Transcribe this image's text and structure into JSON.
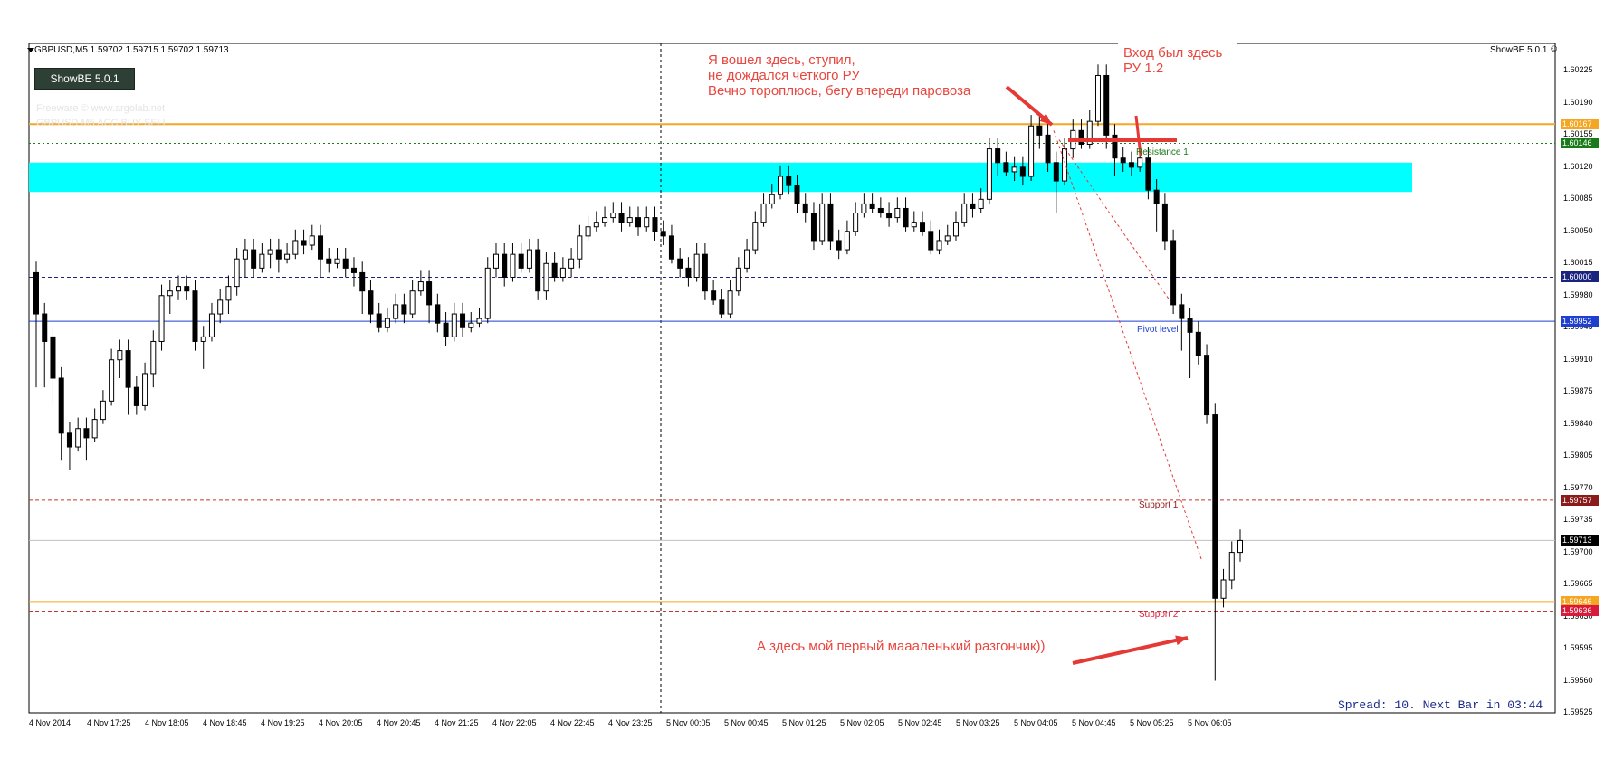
{
  "window": {
    "symbol_header": "GBPUSD,M5  1.59702 1.59715 1.59702 1.59713",
    "indicator_name": "ShowBE 5.0.1",
    "button_label": "ShowBE 5.0.1",
    "faint_text_1": "Freeware © www.argolab.net",
    "faint_text_2": "GBPUSD  M5  ACC  BUY  SELL",
    "spread_text": "Spread: 10. Next Bar in 03:44"
  },
  "annotations": {
    "note_1": [
      "Я вошел здесь, ступил,",
      "не дождался четкого РУ",
      "Вечно тороплюсь, бегу впереди паровоза"
    ],
    "note_2": [
      "Вход был здесь",
      "РУ 1.2"
    ],
    "note_3": "А здесь мой первый маааленький разгончик))"
  },
  "levels": {
    "resistance_1": "Resistance 1",
    "pivot": "Pivot level",
    "support_1": "Support 1",
    "support_2": "Support 2"
  },
  "price_axis": {
    "ticks": [
      "1.60225",
      "1.60190",
      "1.60155",
      "1.60120",
      "1.60085",
      "1.60050",
      "1.60015",
      "1.59980",
      "1.59945",
      "1.59910",
      "1.59875",
      "1.59840",
      "1.59805",
      "1.59770",
      "1.59735",
      "1.59700",
      "1.59665",
      "1.59630",
      "1.59595",
      "1.59560",
      "1.59525"
    ],
    "tags": [
      {
        "text": "1.60167",
        "color": "#f5a623",
        "price": 1.60167
      },
      {
        "text": "1.60146",
        "color": "#1a7a1a",
        "price": 1.60146
      },
      {
        "text": "1.60000",
        "color": "#1a237e",
        "price": 1.6
      },
      {
        "text": "1.59952",
        "color": "#1e3fd0",
        "price": 1.59952
      },
      {
        "text": "1.59757",
        "color": "#8b1a1a",
        "price": 1.59757
      },
      {
        "text": "1.59713",
        "color": "#000000",
        "price": 1.59713
      },
      {
        "text": "1.59646",
        "color": "#f5a623",
        "price": 1.59646
      },
      {
        "text": "1.59636",
        "color": "#d81b3c",
        "price": 1.59636
      }
    ]
  },
  "time_axis": {
    "ticks": [
      "4 Nov 2014",
      "4 Nov 17:25",
      "4 Nov 18:05",
      "4 Nov 18:45",
      "4 Nov 19:25",
      "4 Nov 20:05",
      "4 Nov 20:45",
      "4 Nov 21:25",
      "4 Nov 22:05",
      "4 Nov 22:45",
      "4 Nov 23:25",
      "5 Nov 00:05",
      "5 Nov 00:45",
      "5 Nov 01:25",
      "5 Nov 02:05",
      "5 Nov 02:45",
      "5 Nov 03:25",
      "5 Nov 04:05",
      "5 Nov 04:45",
      "5 Nov 05:25",
      "5 Nov 06:05"
    ]
  },
  "chart_data": {
    "type": "candlestick",
    "symbol": "GBPUSD",
    "timeframe": "M5",
    "ylim": [
      1.59525,
      1.60255
    ],
    "last": {
      "open": 1.59702,
      "high": 1.59715,
      "low": 1.59702,
      "close": 1.59713
    },
    "horizontal_levels": [
      {
        "name": "Resistance 1",
        "price": 1.60146,
        "color": "#1a7a1a",
        "style": "dotted"
      },
      {
        "name": "Pivot level",
        "price": 1.59952,
        "color": "#1e3fd0",
        "style": "solid"
      },
      {
        "name": "Support 1",
        "price": 1.59757,
        "color": "#c0392b",
        "style": "dashed"
      },
      {
        "name": "Support 2",
        "price": 1.59636,
        "color": "#c0392b",
        "style": "dashed"
      },
      {
        "price": 1.60167,
        "color": "#f5a623",
        "style": "solid"
      },
      {
        "price": 1.59646,
        "color": "#f5a623",
        "style": "solid"
      },
      {
        "price": 1.6,
        "color": "#1a237e",
        "style": "dashed"
      }
    ],
    "zone": {
      "from": 1.60093,
      "to": 1.60125,
      "color": "#00ffff"
    },
    "candles": [
      [
        1.60005,
        1.5996,
        1.5988
      ],
      [
        1.5996,
        1.5993,
        1.5988
      ],
      [
        1.59935,
        1.5989,
        1.5986
      ],
      [
        1.5989,
        1.5983,
        1.598
      ],
      [
        1.5983,
        1.59815,
        1.5979
      ],
      [
        1.59815,
        1.59835,
        1.5981
      ],
      [
        1.59835,
        1.59825,
        1.598
      ],
      [
        1.59825,
        1.59845,
        1.5982
      ],
      [
        1.59845,
        1.59865,
        1.5984
      ],
      [
        1.59865,
        1.5991,
        1.5986
      ],
      [
        1.5991,
        1.5992,
        1.5989
      ],
      [
        1.5992,
        1.5988,
        1.5985
      ],
      [
        1.5988,
        1.5986,
        1.5985
      ],
      [
        1.5986,
        1.59895,
        1.59855
      ],
      [
        1.59895,
        1.5993,
        1.5988
      ],
      [
        1.5993,
        1.5998,
        1.5992
      ],
      [
        1.5998,
        1.59985,
        1.5996
      ],
      [
        1.59985,
        1.5999,
        1.59975
      ],
      [
        1.5999,
        1.59985,
        1.59975
      ],
      [
        1.59985,
        1.5993,
        1.5992
      ],
      [
        1.5993,
        1.59935,
        1.599
      ],
      [
        1.59935,
        1.5996,
        1.5993
      ],
      [
        1.5996,
        1.59975,
        1.5995
      ],
      [
        1.59975,
        1.5999,
        1.5996
      ],
      [
        1.5999,
        1.6002,
        1.5998
      ],
      [
        1.6002,
        1.6003,
        1.6
      ],
      [
        1.6003,
        1.6001,
        1.6
      ],
      [
        1.6001,
        1.60025,
        1.60005
      ],
      [
        1.60025,
        1.6003,
        1.6001
      ],
      [
        1.6003,
        1.6002,
        1.60005
      ],
      [
        1.6002,
        1.60025,
        1.60015
      ],
      [
        1.60025,
        1.6004,
        1.6002
      ],
      [
        1.6004,
        1.60035,
        1.60025
      ],
      [
        1.60035,
        1.60045,
        1.6003
      ],
      [
        1.60045,
        1.6002,
        1.6
      ],
      [
        1.6002,
        1.60015,
        1.60005
      ],
      [
        1.60015,
        1.6002,
        1.6001
      ],
      [
        1.6002,
        1.6001,
        1.6
      ],
      [
        1.6001,
        1.60005,
        1.5999
      ],
      [
        1.60005,
        1.59985,
        1.5996
      ],
      [
        1.59985,
        1.5996,
        1.5995
      ],
      [
        1.5996,
        1.59945,
        1.5994
      ],
      [
        1.59945,
        1.59955,
        1.5994
      ],
      [
        1.59955,
        1.5997,
        1.5995
      ],
      [
        1.5997,
        1.5996,
        1.5995
      ],
      [
        1.5996,
        1.59985,
        1.59955
      ],
      [
        1.59985,
        1.59995,
        1.5998
      ],
      [
        1.59995,
        1.5997,
        1.5995
      ],
      [
        1.5997,
        1.5995,
        1.5994
      ],
      [
        1.5995,
        1.59935,
        1.59925
      ],
      [
        1.59935,
        1.5996,
        1.5993
      ],
      [
        1.5996,
        1.59945,
        1.59935
      ],
      [
        1.59945,
        1.5995,
        1.5994
      ],
      [
        1.5995,
        1.59955,
        1.59945
      ],
      [
        1.59955,
        1.6001,
        1.5995
      ],
      [
        1.6001,
        1.60025,
        1.6
      ],
      [
        1.60025,
        1.6,
        1.5999
      ],
      [
        1.6,
        1.60025,
        1.59995
      ],
      [
        1.60025,
        1.6001,
        1.60005
      ],
      [
        1.6001,
        1.6003,
        1.60005
      ],
      [
        1.6003,
        1.59985,
        1.59975
      ],
      [
        1.59985,
        1.60015,
        1.59975
      ],
      [
        1.60015,
        1.6,
        1.59995
      ],
      [
        1.6,
        1.6001,
        1.59995
      ],
      [
        1.6001,
        1.6002,
        1.6
      ],
      [
        1.6002,
        1.60045,
        1.6001
      ],
      [
        1.60045,
        1.60055,
        1.6004
      ],
      [
        1.60055,
        1.6006,
        1.6005
      ],
      [
        1.6006,
        1.60065,
        1.60055
      ],
      [
        1.60065,
        1.6007,
        1.6006
      ],
      [
        1.6007,
        1.6006,
        1.6005
      ],
      [
        1.6006,
        1.60065,
        1.60055
      ],
      [
        1.60065,
        1.60055,
        1.60045
      ],
      [
        1.60055,
        1.60065,
        1.6005
      ],
      [
        1.60065,
        1.6005,
        1.6004
      ],
      [
        1.6005,
        1.60045,
        1.60035
      ],
      [
        1.60045,
        1.6002,
        1.60015
      ],
      [
        1.6002,
        1.6001,
        1.6
      ],
      [
        1.6001,
        1.6,
        1.5999
      ],
      [
        1.6,
        1.60025,
        1.59995
      ],
      [
        1.60025,
        1.59985,
        1.59975
      ],
      [
        1.59985,
        1.59975,
        1.5997
      ],
      [
        1.59975,
        1.5996,
        1.59955
      ],
      [
        1.5996,
        1.59985,
        1.59955
      ],
      [
        1.59985,
        1.6001,
        1.5998
      ],
      [
        1.6001,
        1.6003,
        1.60005
      ],
      [
        1.6003,
        1.6006,
        1.60025
      ],
      [
        1.6006,
        1.6008,
        1.60055
      ],
      [
        1.6008,
        1.6009,
        1.60075
      ],
      [
        1.6009,
        1.6011,
        1.60085
      ],
      [
        1.6011,
        1.601,
        1.6009
      ],
      [
        1.601,
        1.6008,
        1.6007
      ],
      [
        1.6008,
        1.6007,
        1.6006
      ],
      [
        1.6007,
        1.6004,
        1.6003
      ],
      [
        1.6004,
        1.6008,
        1.60035
      ],
      [
        1.6008,
        1.6004,
        1.6003
      ],
      [
        1.6004,
        1.6003,
        1.6002
      ],
      [
        1.6003,
        1.6005,
        1.60025
      ],
      [
        1.6005,
        1.6007,
        1.60045
      ],
      [
        1.6007,
        1.6008,
        1.60065
      ],
      [
        1.6008,
        1.60075,
        1.6007
      ],
      [
        1.60075,
        1.6007,
        1.60065
      ],
      [
        1.6007,
        1.60065,
        1.60055
      ],
      [
        1.60065,
        1.60075,
        1.6006
      ],
      [
        1.60075,
        1.60055,
        1.6005
      ],
      [
        1.60055,
        1.6006,
        1.6005
      ],
      [
        1.6006,
        1.6005,
        1.60045
      ],
      [
        1.6005,
        1.6003,
        1.60025
      ],
      [
        1.6003,
        1.6004,
        1.60025
      ],
      [
        1.6004,
        1.60045,
        1.60035
      ],
      [
        1.60045,
        1.6006,
        1.6004
      ],
      [
        1.6006,
        1.6008,
        1.60055
      ],
      [
        1.6008,
        1.60075,
        1.60065
      ],
      [
        1.60075,
        1.60085,
        1.6007
      ],
      [
        1.60085,
        1.6014,
        1.6008
      ],
      [
        1.6014,
        1.60125,
        1.6011
      ],
      [
        1.60125,
        1.60115,
        1.6011
      ],
      [
        1.60115,
        1.6012,
        1.60105
      ],
      [
        1.6012,
        1.6011,
        1.601
      ],
      [
        1.6011,
        1.60165,
        1.60105
      ],
      [
        1.60165,
        1.60155,
        1.6014
      ],
      [
        1.60155,
        1.60125,
        1.60115
      ],
      [
        1.60125,
        1.60105,
        1.6007
      ],
      [
        1.60105,
        1.6014,
        1.601
      ],
      [
        1.6014,
        1.6016,
        1.6013
      ],
      [
        1.6016,
        1.60145,
        1.6014
      ],
      [
        1.60145,
        1.6017,
        1.6014
      ],
      [
        1.6017,
        1.6022,
        1.60165
      ],
      [
        1.6022,
        1.60155,
        1.6014
      ],
      [
        1.60155,
        1.6013,
        1.6011
      ],
      [
        1.6013,
        1.60125,
        1.60115
      ],
      [
        1.60125,
        1.6012,
        1.6011
      ],
      [
        1.6012,
        1.6013,
        1.60115
      ],
      [
        1.6013,
        1.60095,
        1.60085
      ],
      [
        1.60095,
        1.6008,
        1.6005
      ],
      [
        1.6008,
        1.6004,
        1.6003
      ],
      [
        1.6004,
        1.5997,
        1.5996
      ],
      [
        1.5997,
        1.59955,
        1.5992
      ],
      [
        1.59955,
        1.5994,
        1.5989
      ],
      [
        1.5994,
        1.59915,
        1.59905
      ],
      [
        1.59915,
        1.5985,
        1.5984
      ],
      [
        1.5985,
        1.5965,
        1.5956
      ],
      [
        1.5965,
        1.5967,
        1.5964
      ],
      [
        1.5967,
        1.597,
        1.5966
      ],
      [
        1.597,
        1.59713,
        1.5969
      ]
    ]
  }
}
